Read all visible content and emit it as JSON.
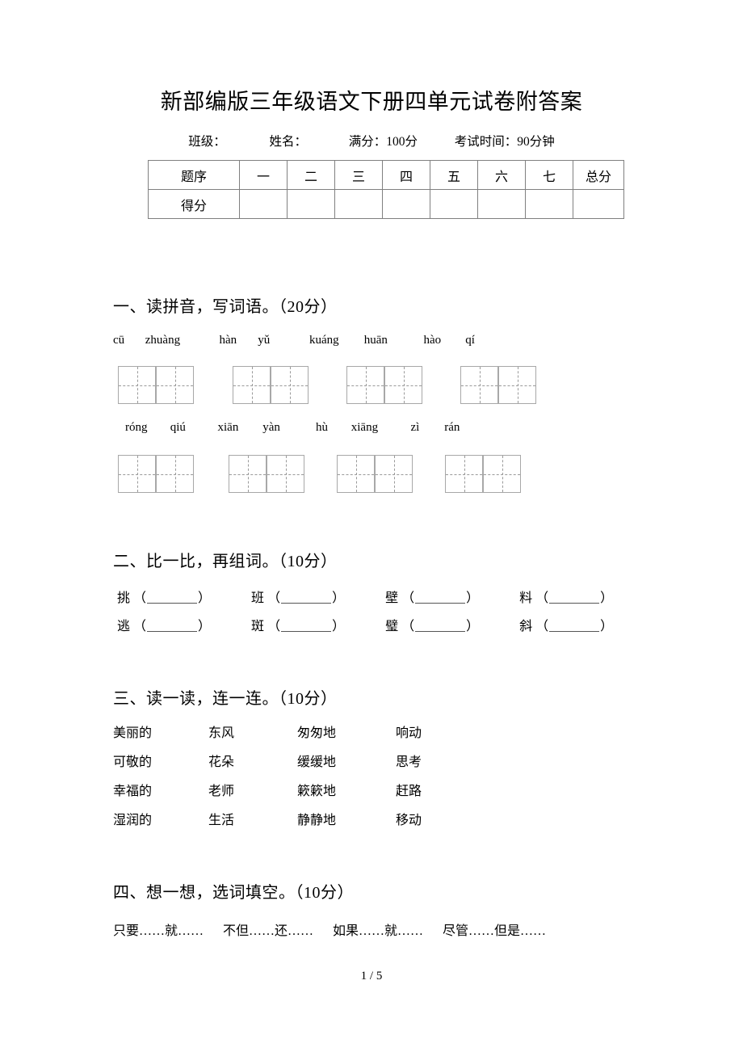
{
  "document": {
    "title": "新部编版三年级语文下册四单元试卷附答案",
    "footer": "1 / 5"
  },
  "info": {
    "class_label": "班级：",
    "name_label": "姓名：",
    "full_score": "满分：100分",
    "exam_time": "考试时间：90分钟"
  },
  "score_table": {
    "rows": [
      {
        "label": "题序",
        "cells": [
          "一",
          "二",
          "三",
          "四",
          "五",
          "六",
          "七",
          "总分"
        ]
      },
      {
        "label": "得分",
        "cells": [
          "",
          "",
          "",
          "",
          "",
          "",
          "",
          ""
        ]
      }
    ]
  },
  "sections": {
    "one": {
      "heading": "一、读拼音，写词语。（20分）",
      "pinyin_row_1": [
        "cū",
        "zhuàng",
        "hàn",
        "yǔ",
        "kuáng",
        "huān",
        "hào",
        "qí"
      ],
      "pinyin_row_2": [
        "róng",
        "qiú",
        "xiān",
        "yàn",
        "hù",
        "xiāng",
        "zì",
        "rán"
      ],
      "grid_groups_row_1": 4,
      "grid_groups_row_2": 4,
      "cells_per_group": 2
    },
    "two": {
      "heading": "二、比一比，再组词。（10分）",
      "row_1": [
        "挑",
        "班",
        "壁",
        "料"
      ],
      "row_2": [
        "逃",
        "斑",
        "璧",
        "斜"
      ]
    },
    "three": {
      "heading": "三、读一读，连一连。（10分）",
      "rows": [
        [
          "美丽的",
          "东风",
          "匆匆地",
          "响动"
        ],
        [
          "可敬的",
          "花朵",
          "缓缓地",
          "思考"
        ],
        [
          "幸福的",
          "老师",
          "簌簌地",
          "赶路"
        ],
        [
          "湿润的",
          "生活",
          "静静地",
          "移动"
        ]
      ]
    },
    "four": {
      "heading": "四、想一想，选词填空。（10分）",
      "word_bank": [
        "只要……就……",
        "不但……还……",
        "如果……就……",
        "尽管……但是……"
      ]
    }
  }
}
